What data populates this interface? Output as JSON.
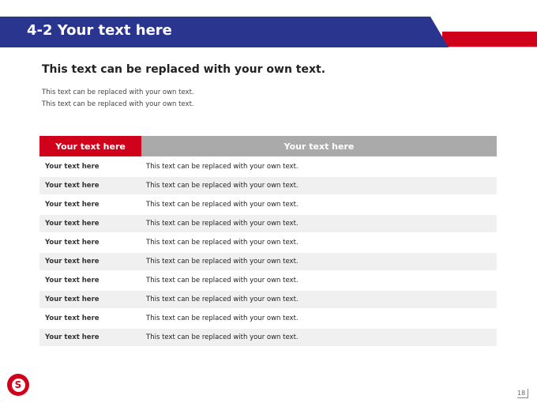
{
  "header": {
    "title": "4-2 Your text here",
    "accent_color": "#d0021b",
    "brand_color": "#2a3590"
  },
  "content": {
    "subtitle": "This text can be replaced with your own text.",
    "lines": [
      "This text can be replaced with your own text.",
      "This text can be replaced with your own text."
    ]
  },
  "table": {
    "headers": [
      "Your text here",
      "Your text here"
    ],
    "rows": [
      [
        "Your text here",
        "This text can be replaced with your own text."
      ],
      [
        "Your text here",
        "This text can be replaced with your own text."
      ],
      [
        "Your text here",
        "This text can be replaced with your own text."
      ],
      [
        "Your text here",
        "This text can be replaced with your own text."
      ],
      [
        "Your text here",
        "This text can be replaced with your own text."
      ],
      [
        "Your text here",
        "This text can be replaced with your own text."
      ],
      [
        "Your text here",
        "This text can be replaced with your own text."
      ],
      [
        "Your text here",
        "This text can be replaced with your own text."
      ],
      [
        "Your text here",
        "This text can be replaced with your own text."
      ],
      [
        "Your text here",
        "This text can be replaced with your own text."
      ]
    ]
  },
  "footer": {
    "logo_letter": "S",
    "page_number": "18"
  }
}
